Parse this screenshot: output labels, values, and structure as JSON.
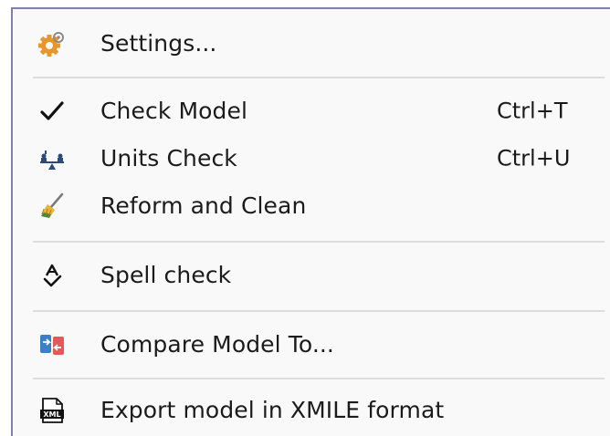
{
  "menu": {
    "items": [
      {
        "label": "Settings...",
        "shortcut": "",
        "icon": "settings-gear-icon"
      },
      {
        "label": "Check Model",
        "shortcut": "Ctrl+T",
        "icon": "checkmark-icon"
      },
      {
        "label": "Units Check",
        "shortcut": "Ctrl+U",
        "icon": "units-balance-icon"
      },
      {
        "label": "Reform and Clean",
        "shortcut": "",
        "icon": "broom-icon"
      },
      {
        "label": "Spell check",
        "shortcut": "",
        "icon": "spell-check-icon"
      },
      {
        "label": "Compare Model To...",
        "shortcut": "",
        "icon": "compare-models-icon"
      },
      {
        "label": "Export model in XMILE format",
        "shortcut": "",
        "icon": "xml-file-icon"
      }
    ],
    "colors": {
      "background": "#f9f9f9",
      "text": "#1b1b1b",
      "separator": "#dddddd",
      "border": "#7f7fa8"
    },
    "icon_text": {
      "xml": "XML"
    }
  }
}
